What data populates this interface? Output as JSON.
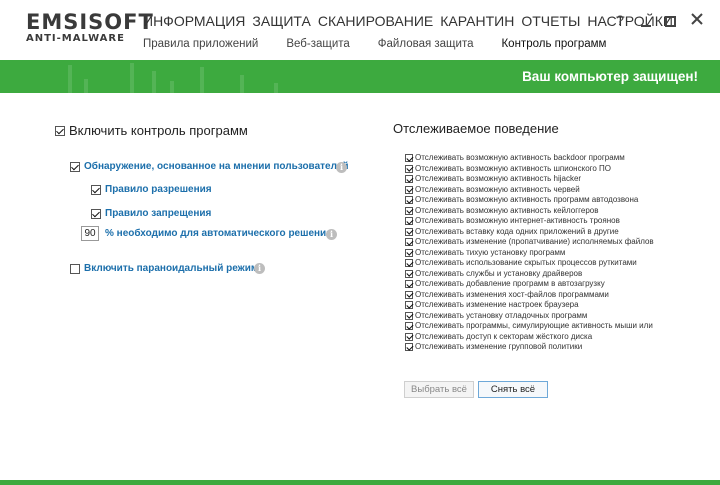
{
  "logo": {
    "main": "EMSISOFT",
    "sub": "ANTI-MALWARE"
  },
  "main_nav": [
    "ИНФОРМАЦИЯ",
    "ЗАЩИТА",
    "СКАНИРОВАНИЕ",
    "КАРАНТИН",
    "ОТЧЕТЫ",
    "НАСТРОЙКИ"
  ],
  "sub_nav": [
    {
      "label": "Правила приложений",
      "active": false
    },
    {
      "label": "Веб-защита",
      "active": false
    },
    {
      "label": "Файловая защита",
      "active": false
    },
    {
      "label": "Контроль программ",
      "active": true
    }
  ],
  "window": {
    "help": "?"
  },
  "status": {
    "text": "Ваш компьютер защищен!",
    "color": "#3daa3f"
  },
  "left": {
    "enable_label": "Включить контроль программ",
    "enable_checked": true,
    "community_label": "Обнаружение, основанное на мнении пользователей",
    "community_checked": true,
    "allow_rule_label": "Правило разрешения",
    "allow_rule_checked": true,
    "deny_rule_label": "Правило запрещения",
    "deny_rule_checked": true,
    "threshold_value": "90",
    "threshold_label": "% необходимо для автоматического решения",
    "paranoid_label": "Включить параноидальный режим",
    "paranoid_checked": false
  },
  "right": {
    "title": "Отслеживаемое поведение",
    "items": [
      "Отслеживать возможную активность backdoor программ",
      "Отслеживать возможную активность шпионского ПО",
      "Отслеживать возможную активность hijacker",
      "Отслеживать возможную активность червей",
      "Отслеживать возможную активность программ автодозвона",
      "Отслеживать возможную активность кейлоггеров",
      "Отслеживать возможную интернет-активность троянов",
      "Отслеживать вставку кода одних приложений в другие",
      "Отслеживать изменение (пропатчивание) исполняемых файлов",
      "Отслеживать тихую установку программ",
      "Отслеживать использование скрытых процессов руткитами",
      "Отслеживать службы и установку драйверов",
      "Отслеживать добавление программ в автозагрузку",
      "Отслеживать изменения хост-файлов программами",
      "Отслеживать изменение настроек браузера",
      "Отслеживать установку отладочных программ",
      "Отслеживать программы, симулирующие активность мыши или",
      "Отслеживать доступ к секторам жёсткого диска",
      "Отслеживать изменение групповой политики"
    ],
    "select_all": "Выбрать всё",
    "deselect_all": "Снять всё"
  },
  "colors": {
    "accent_green": "#3daa3f",
    "link_blue": "#1c6fab"
  },
  "icons": [
    "help-icon",
    "minimize-icon",
    "maximize-icon",
    "close-icon",
    "info-icon"
  ]
}
